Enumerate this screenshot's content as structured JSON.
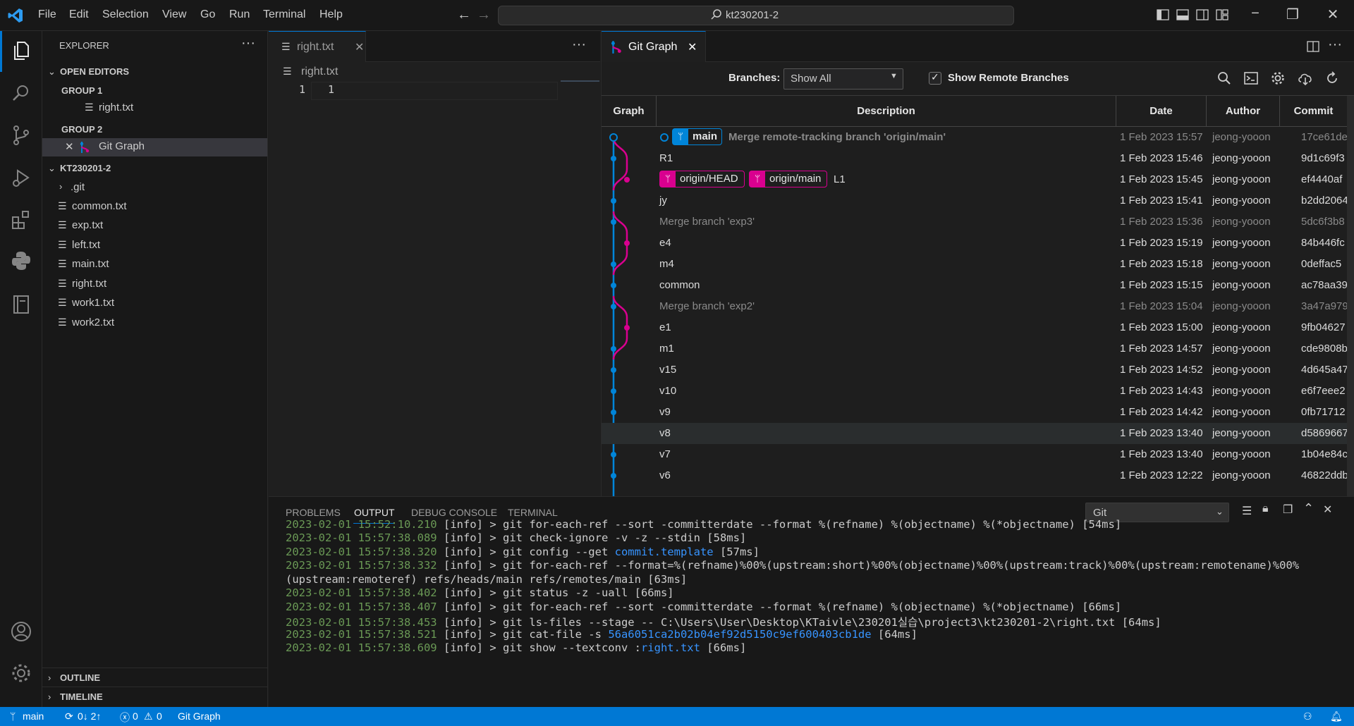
{
  "titlebar": {
    "menu": [
      "File",
      "Edit",
      "Selection",
      "View",
      "Go",
      "Run",
      "Terminal",
      "Help"
    ],
    "search_text": "kt230201-2"
  },
  "sidebar": {
    "title": "EXPLORER",
    "open_editors_label": "OPEN EDITORS",
    "group1_label": "GROUP 1",
    "group1_file": "right.txt",
    "group2_label": "GROUP 2",
    "group2_file": "Git Graph",
    "folder_label": "KT230201-2",
    "files": [
      ".git",
      "common.txt",
      "exp.txt",
      "left.txt",
      "main.txt",
      "right.txt",
      "work1.txt",
      "work2.txt"
    ],
    "outline_label": "OUTLINE",
    "timeline_label": "TIMELINE"
  },
  "editor1": {
    "tab_label": "right.txt",
    "breadcrumb": "right.txt",
    "line_number": "1",
    "line_text": "1"
  },
  "gitgraph": {
    "tab_label": "Git Graph",
    "branches_label": "Branches:",
    "branches_value": "Show All",
    "show_remote_label": "Show Remote Branches",
    "headers": {
      "graph": "Graph",
      "description": "Description",
      "date": "Date",
      "author": "Author",
      "commit": "Commit"
    },
    "refs": {
      "main": "main",
      "origin_head": "origin/HEAD",
      "origin_main": "origin/main"
    },
    "commits": [
      {
        "desc": "Merge remote-tracking branch 'origin/main'",
        "date": "1 Feb 2023 15:57",
        "author": "jeong-yooon",
        "hash": "17ce61de"
      },
      {
        "desc": "R1",
        "date": "1 Feb 2023 15:46",
        "author": "jeong-yooon",
        "hash": "9d1c69f3"
      },
      {
        "desc": "L1",
        "date": "1 Feb 2023 15:45",
        "author": "jeong-yooon",
        "hash": "ef4440af"
      },
      {
        "desc": "jy",
        "date": "1 Feb 2023 15:41",
        "author": "jeong-yooon",
        "hash": "b2dd2064"
      },
      {
        "desc": "Merge branch 'exp3'",
        "date": "1 Feb 2023 15:36",
        "author": "jeong-yooon",
        "hash": "5dc6f3b8"
      },
      {
        "desc": "e4",
        "date": "1 Feb 2023 15:19",
        "author": "jeong-yooon",
        "hash": "84b446fc"
      },
      {
        "desc": "m4",
        "date": "1 Feb 2023 15:18",
        "author": "jeong-yooon",
        "hash": "0deffac5"
      },
      {
        "desc": "common",
        "date": "1 Feb 2023 15:15",
        "author": "jeong-yooon",
        "hash": "ac78aa39"
      },
      {
        "desc": "Merge branch 'exp2'",
        "date": "1 Feb 2023 15:04",
        "author": "jeong-yooon",
        "hash": "3a47a979"
      },
      {
        "desc": "e1",
        "date": "1 Feb 2023 15:00",
        "author": "jeong-yooon",
        "hash": "9fb04627"
      },
      {
        "desc": "m1",
        "date": "1 Feb 2023 14:57",
        "author": "jeong-yooon",
        "hash": "cde9808b"
      },
      {
        "desc": "v15",
        "date": "1 Feb 2023 14:52",
        "author": "jeong-yooon",
        "hash": "4d645a47"
      },
      {
        "desc": "v10",
        "date": "1 Feb 2023 14:43",
        "author": "jeong-yooon",
        "hash": "e6f7eee2"
      },
      {
        "desc": "v9",
        "date": "1 Feb 2023 14:42",
        "author": "jeong-yooon",
        "hash": "0fb71712"
      },
      {
        "desc": "v8",
        "date": "1 Feb 2023 13:40",
        "author": "jeong-yooon",
        "hash": "d5869667"
      },
      {
        "desc": "v7",
        "date": "1 Feb 2023 13:40",
        "author": "jeong-yooon",
        "hash": "1b04e84c"
      },
      {
        "desc": "v6",
        "date": "1 Feb 2023 12:22",
        "author": "jeong-yooon",
        "hash": "46822ddb"
      }
    ]
  },
  "panel": {
    "tabs": [
      "PROBLEMS",
      "OUTPUT",
      "DEBUG CONSOLE",
      "TERMINAL"
    ],
    "channel": "Git",
    "log": [
      {
        "ts": "2023-02-01 15:52:10.210",
        "lvl": "[info]",
        "cmd": "> git for-each-ref --sort -committerdate --format %(refname) %(objectname) %(*objectname) [54ms]"
      },
      {
        "ts": "2023-02-01 15:57:38.089",
        "lvl": "[info]",
        "cmd": "> git check-ignore -v -z --stdin [58ms]"
      },
      {
        "ts": "2023-02-01 15:57:38.320",
        "lvl": "[info]",
        "cmd_a": "> git config --get ",
        "link": "commit.template",
        "cmd_b": " [57ms]"
      },
      {
        "ts": "2023-02-01 15:57:38.332",
        "lvl": "[info]",
        "cmd": "> git for-each-ref --format=%(refname)%00%(upstream:short)%00%(objectname)%00%(upstream:track)%00%(upstream:remotename)%00%"
      },
      {
        "cont": "(upstream:remoteref) refs/heads/main refs/remotes/main [63ms]"
      },
      {
        "ts": "2023-02-01 15:57:38.402",
        "lvl": "[info]",
        "cmd": "> git status -z -uall [66ms]"
      },
      {
        "ts": "2023-02-01 15:57:38.407",
        "lvl": "[info]",
        "cmd": "> git for-each-ref --sort -committerdate --format %(refname) %(objectname) %(*objectname) [66ms]"
      },
      {
        "ts": "2023-02-01 15:57:38.453",
        "lvl": "[info]",
        "cmd": "> git ls-files --stage -- C:\\Users\\User\\Desktop\\KTaivle\\230201실습\\project3\\kt230201-2\\right.txt [64ms]"
      },
      {
        "ts": "2023-02-01 15:57:38.521",
        "lvl": "[info]",
        "cmd_a": "> git cat-file -s ",
        "link": "56a6051ca2b02b04ef92d5150c9ef600403cb1de",
        "cmd_b": " [64ms]"
      },
      {
        "ts": "2023-02-01 15:57:38.609",
        "lvl": "[info]",
        "cmd_a": "> git show --textconv :",
        "link": "right.txt",
        "cmd_b": " [66ms]"
      }
    ]
  },
  "statusbar": {
    "branch": "main",
    "sync": "0↓ 2↑",
    "errors": "0",
    "warnings": "0",
    "gitgraph": "Git Graph"
  },
  "colors": {
    "accent": "#0078d4",
    "branch_blue": "#0085d9",
    "branch_pink": "#d9008f"
  }
}
